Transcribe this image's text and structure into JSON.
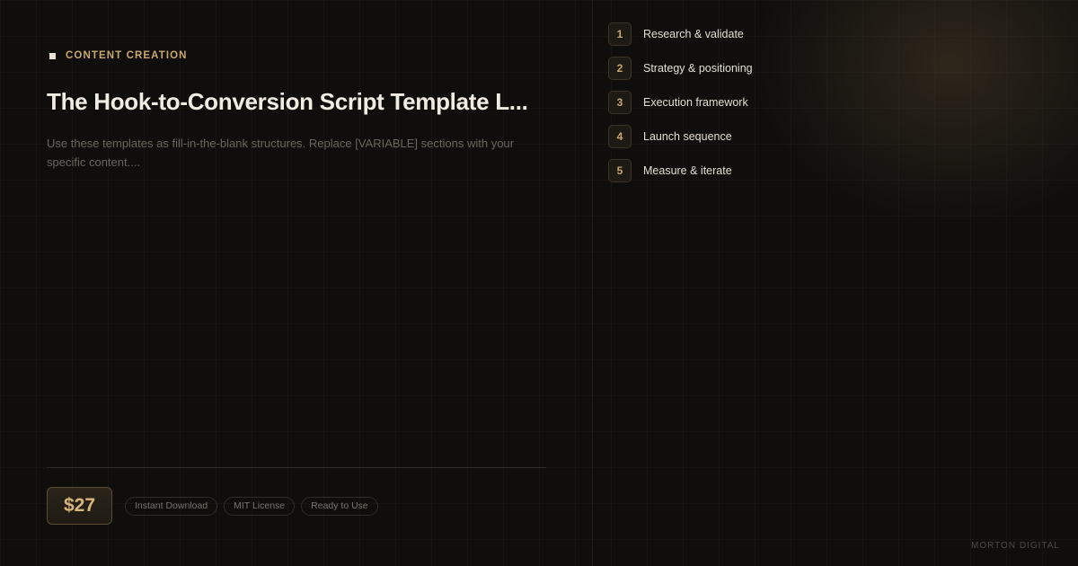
{
  "category": {
    "label": "CONTENT CREATION"
  },
  "title": "The Hook-to-Conversion Script Template L...",
  "description": "Use these templates as fill-in-the-blank structures. Replace [VARIABLE] sections with your specific content....",
  "price": "$27",
  "tags": [
    "Instant Download",
    "MIT License",
    "Ready to Use"
  ],
  "steps": [
    {
      "number": "1",
      "label": "Research & validate"
    },
    {
      "number": "2",
      "label": "Strategy & positioning"
    },
    {
      "number": "3",
      "label": "Execution framework"
    },
    {
      "number": "4",
      "label": "Launch sequence"
    },
    {
      "number": "5",
      "label": "Measure & iterate"
    }
  ],
  "brand": "MORTON DIGITAL",
  "colors": {
    "background": "#0f0e0d",
    "accent": "#c9a86a",
    "price_text": "#d9b77a",
    "title": "#f1ece2"
  },
  "icons": {
    "category_marker": "square-icon"
  }
}
